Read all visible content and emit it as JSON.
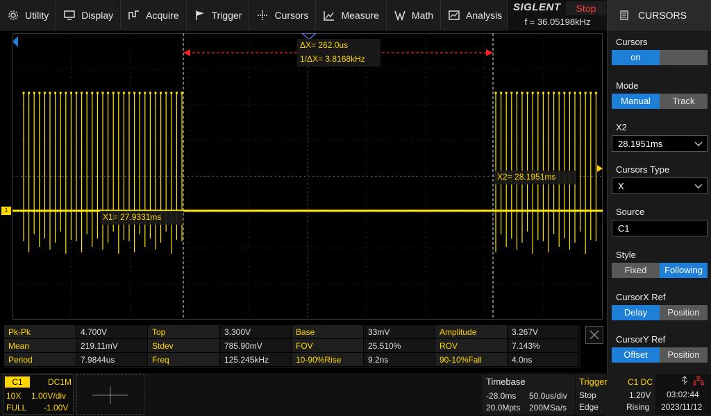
{
  "menu": [
    {
      "label": "Utility",
      "icon": "gear-icon"
    },
    {
      "label": "Display",
      "icon": "monitor-icon"
    },
    {
      "label": "Acquire",
      "icon": "acquire-icon"
    },
    {
      "label": "Trigger",
      "icon": "flag-icon"
    },
    {
      "label": "Cursors",
      "icon": "cursor-icon"
    },
    {
      "label": "Measure",
      "icon": "measure-icon"
    },
    {
      "label": "Math",
      "icon": "math-icon"
    },
    {
      "label": "Analysis",
      "icon": "analysis-icon"
    }
  ],
  "brand": {
    "name": "SIGLENT",
    "run_state": "Stop",
    "freq": "f = 36.05198kHz"
  },
  "panel": {
    "title": "CURSORS",
    "cursors_label": "Cursors",
    "cursors_on": "on",
    "mode_label": "Mode",
    "mode_manual": "Manual",
    "mode_track": "Track",
    "x2_label": "X2",
    "x2_value": "28.1951ms",
    "type_label": "Cursors Type",
    "type_value": "X",
    "source_label": "Source",
    "source_value": "C1",
    "style_label": "Style",
    "style_fixed": "Fixed",
    "style_following": "Following",
    "xref_label": "CursorX Ref",
    "xref_delay": "Delay",
    "xref_position": "Position",
    "yref_label": "CursorY Ref",
    "yref_offset": "Offset",
    "yref_position": "Position"
  },
  "scope": {
    "delta_x": "ΔX= 262.0us",
    "inv_delta_x": "1/ΔX= 3.8168kHz",
    "x1_readout": "X1= 27.9331ms",
    "x2_readout": "X2= 28.1951ms",
    "trace_color": "#ffe600",
    "cursor_color": "#ff2020"
  },
  "measurements": [
    [
      {
        "l": "Pk-Pk",
        "v": "4.700V"
      },
      {
        "l": "Top",
        "v": "3.300V"
      },
      {
        "l": "Base",
        "v": "33mV"
      },
      {
        "l": "Amplitude",
        "v": "3.267V"
      }
    ],
    [
      {
        "l": "Mean",
        "v": "219.11mV"
      },
      {
        "l": "Stdev",
        "v": "785.90mV"
      },
      {
        "l": "FOV",
        "v": "25.510%"
      },
      {
        "l": "ROV",
        "v": "7.143%"
      }
    ],
    [
      {
        "l": "Period",
        "v": "7.9844us"
      },
      {
        "l": "Freq",
        "v": "125.245kHz"
      },
      {
        "l": "10-90%Rise",
        "v": "9.2ns"
      },
      {
        "l": "90-10%Fall",
        "v": "4.0ns"
      }
    ]
  ],
  "channel": {
    "name": "C1",
    "coupling": "DC1M",
    "probe": "10X",
    "vdiv": "1.00V/div",
    "bw": "FULL",
    "offset": "-1.00V"
  },
  "timebase": {
    "title": "Timebase",
    "delay": "-28.0ms",
    "tdiv": "50.0us/div",
    "points": "20.0Mpts",
    "rate": "200MSa/s"
  },
  "trigger": {
    "title": "Trigger",
    "source": "C1 DC",
    "mode": "Stop",
    "level": "1.20V",
    "type": "Edge",
    "slope": "Rising"
  },
  "clock": {
    "time": "03:02:44",
    "date": "2023/11/12"
  }
}
